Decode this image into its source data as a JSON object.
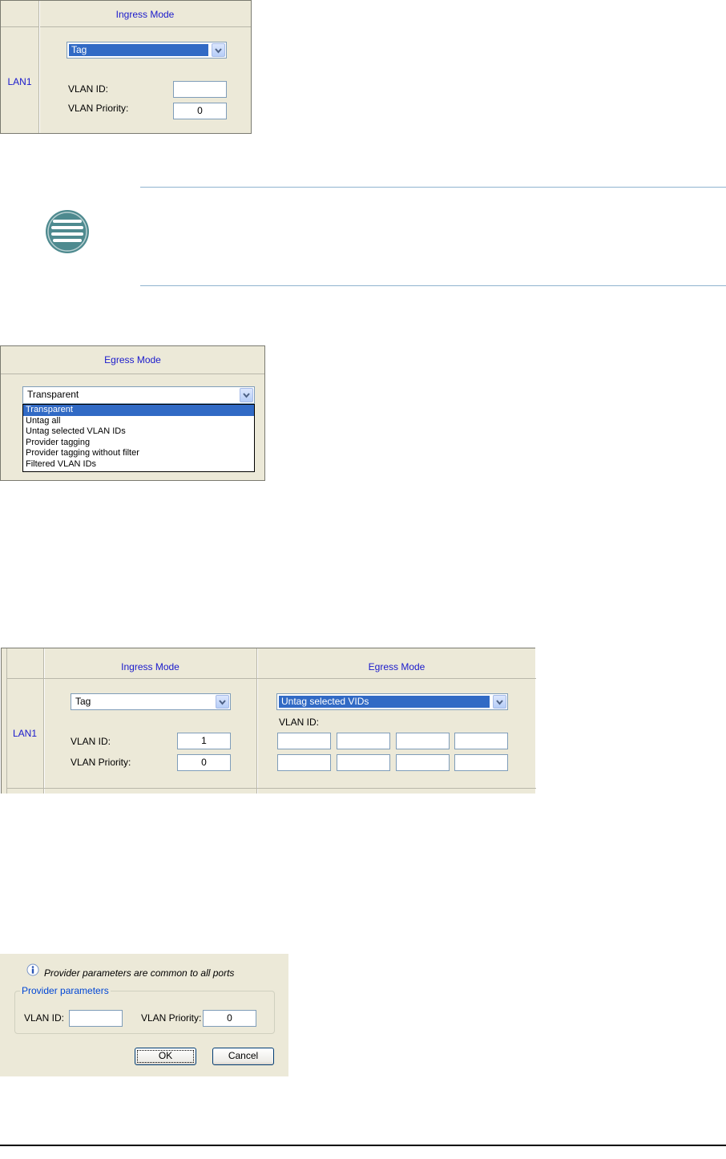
{
  "ingress_panel": {
    "header": "Ingress Mode",
    "port_label": "LAN1",
    "mode_value": "Tag",
    "vlan_id_label": "VLAN ID:",
    "vlan_id_value": "",
    "vlan_priority_label": "VLAN Priority:",
    "vlan_priority_value": "0"
  },
  "note": {
    "icon": "note-icon"
  },
  "egress_panel": {
    "header": "Egress Mode",
    "mode_value": "Transparent",
    "options": [
      "Transparent",
      "Untag all",
      "Untag selected VLAN IDs",
      "Provider tagging",
      "Provider tagging without filter",
      "Filtered VLAN IDs"
    ]
  },
  "combined_panel": {
    "ingress_header": "Ingress Mode",
    "egress_header": "Egress Mode",
    "port_label": "LAN1",
    "ingress_mode_value": "Tag",
    "vlan_id_label": "VLAN ID:",
    "vlan_id_value": "1",
    "vlan_priority_label": "VLAN Priority:",
    "vlan_priority_value": "0",
    "egress_mode_value": "Untag selected VIDs",
    "egress_vlan_id_label": "VLAN ID:",
    "egress_vlan_ids": [
      "",
      "",
      "",
      "",
      "",
      "",
      "",
      ""
    ]
  },
  "provider_dialog": {
    "info_icon": "info-icon",
    "info_text": "Provider parameters are common to all ports",
    "group_title": "Provider parameters",
    "vlan_id_label": "VLAN ID:",
    "vlan_id_value": "",
    "vlan_priority_label": "VLAN Priority:",
    "vlan_priority_value": "0",
    "ok_label": "OK",
    "cancel_label": "Cancel"
  },
  "colors": {
    "panel_bg": "#ece9d8",
    "header_text": "#1a1acc",
    "selection": "#316ac5",
    "note_icon": "#4e8a8f"
  }
}
